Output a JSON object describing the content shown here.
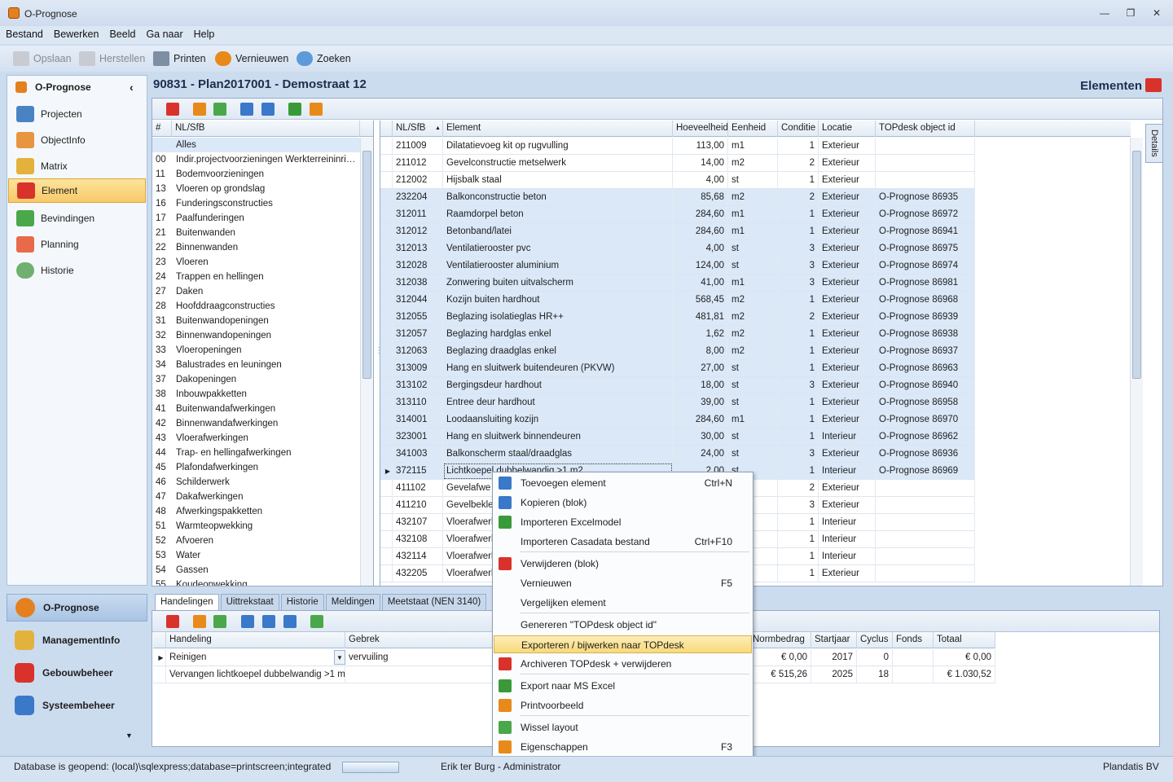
{
  "window": {
    "title": "O-Prognose"
  },
  "menu": [
    "Bestand",
    "Bewerken",
    "Beeld",
    "Ga naar",
    "Help"
  ],
  "toolbar": {
    "save": "Opslaan",
    "restore": "Herstellen",
    "print": "Printen",
    "refresh": "Vernieuwen",
    "search": "Zoeken"
  },
  "nav": {
    "header": "O-Prognose",
    "items": [
      "Projecten",
      "ObjectInfo",
      "Matrix",
      "Element",
      "Bevindingen",
      "Planning",
      "Historie"
    ],
    "selected": "Element",
    "modules": [
      "O-Prognose",
      "ManagementInfo",
      "Gebouwbeheer",
      "Systeembeheer"
    ]
  },
  "page": {
    "title": "90831 - Plan2017001 - Demostraat 12",
    "section": "Elementen",
    "details_tab": "Details"
  },
  "left_grid": {
    "headers": [
      "#",
      "NL/SfB"
    ],
    "rows": [
      [
        "",
        "Alles"
      ],
      [
        "00",
        "Indir.projectvoorzieningen Werkterreininrich..."
      ],
      [
        "11",
        "Bodemvoorzieningen"
      ],
      [
        "13",
        "Vloeren op grondslag"
      ],
      [
        "16",
        "Funderingsconstructies"
      ],
      [
        "17",
        "Paalfunderingen"
      ],
      [
        "21",
        "Buitenwanden"
      ],
      [
        "22",
        "Binnenwanden"
      ],
      [
        "23",
        "Vloeren"
      ],
      [
        "24",
        "Trappen en hellingen"
      ],
      [
        "27",
        "Daken"
      ],
      [
        "28",
        "Hoofddraagconstructies"
      ],
      [
        "31",
        "Buitenwandopeningen"
      ],
      [
        "32",
        "Binnenwandopeningen"
      ],
      [
        "33",
        "Vloeropeningen"
      ],
      [
        "34",
        "Balustrades en leuningen"
      ],
      [
        "37",
        "Dakopeningen"
      ],
      [
        "38",
        "Inbouwpakketten"
      ],
      [
        "41",
        "Buitenwandafwerkingen"
      ],
      [
        "42",
        "Binnenwandafwerkingen"
      ],
      [
        "43",
        "Vloerafwerkingen"
      ],
      [
        "44",
        "Trap- en hellingafwerkingen"
      ],
      [
        "45",
        "Plafondafwerkingen"
      ],
      [
        "46",
        "Schilderwerk"
      ],
      [
        "47",
        "Dakafwerkingen"
      ],
      [
        "48",
        "Afwerkingspakketten"
      ],
      [
        "51",
        "Warmteopwekking"
      ],
      [
        "52",
        "Afvoeren"
      ],
      [
        "53",
        "Water"
      ],
      [
        "54",
        "Gassen"
      ],
      [
        "55",
        "Koudeopwekking"
      ]
    ]
  },
  "element_grid": {
    "headers": [
      "NL/SfB",
      "Element",
      "Hoeveelheid",
      "Eenheid",
      "Conditie",
      "Locatie",
      "TOPdesk object id"
    ],
    "rows": [
      [
        "211009",
        "Dilatatievoeg kit op rugvulling",
        "113,00",
        "m1",
        "1",
        "Exterieur",
        ""
      ],
      [
        "211012",
        "Gevelconstructie metselwerk",
        "14,00",
        "m2",
        "2",
        "Exterieur",
        ""
      ],
      [
        "212002",
        "Hijsbalk staal",
        "4,00",
        "st",
        "1",
        "Exterieur",
        ""
      ],
      [
        "232204",
        "Balkonconstructie beton",
        "85,68",
        "m2",
        "2",
        "Exterieur",
        "O-Prognose 86935"
      ],
      [
        "312011",
        "Raamdorpel beton",
        "284,60",
        "m1",
        "1",
        "Exterieur",
        "O-Prognose 86972"
      ],
      [
        "312012",
        "Betonband/latei",
        "284,60",
        "m1",
        "1",
        "Exterieur",
        "O-Prognose 86941"
      ],
      [
        "312013",
        "Ventilatierooster pvc",
        "4,00",
        "st",
        "3",
        "Exterieur",
        "O-Prognose 86975"
      ],
      [
        "312028",
        "Ventilatierooster aluminium",
        "124,00",
        "st",
        "3",
        "Exterieur",
        "O-Prognose 86974"
      ],
      [
        "312038",
        "Zonwering buiten uitvalscherm",
        "41,00",
        "m1",
        "3",
        "Exterieur",
        "O-Prognose 86981"
      ],
      [
        "312044",
        "Kozijn buiten hardhout",
        "568,45",
        "m2",
        "1",
        "Exterieur",
        "O-Prognose 86968"
      ],
      [
        "312055",
        "Beglazing isolatieglas HR++",
        "481,81",
        "m2",
        "2",
        "Exterieur",
        "O-Prognose 86939"
      ],
      [
        "312057",
        "Beglazing hardglas enkel",
        "1,62",
        "m2",
        "1",
        "Exterieur",
        "O-Prognose 86938"
      ],
      [
        "312063",
        "Beglazing draadglas enkel",
        "8,00",
        "m2",
        "1",
        "Exterieur",
        "O-Prognose 86937"
      ],
      [
        "313009",
        "Hang en sluitwerk buitendeuren (PKVW)",
        "27,00",
        "st",
        "1",
        "Exterieur",
        "O-Prognose 86963"
      ],
      [
        "313102",
        "Bergingsdeur hardhout",
        "18,00",
        "st",
        "3",
        "Exterieur",
        "O-Prognose 86940"
      ],
      [
        "313110",
        "Entree deur hardhout",
        "39,00",
        "st",
        "1",
        "Exterieur",
        "O-Prognose 86958"
      ],
      [
        "314001",
        "Loodaansluiting kozijn",
        "284,60",
        "m1",
        "1",
        "Exterieur",
        "O-Prognose 86970"
      ],
      [
        "323001",
        "Hang en sluitwerk binnendeuren",
        "30,00",
        "st",
        "1",
        "Interieur",
        "O-Prognose 86962"
      ],
      [
        "341003",
        "Balkonscherm staal/draadglas",
        "24,00",
        "st",
        "3",
        "Exterieur",
        "O-Prognose 86936"
      ],
      [
        "372115",
        "Lichtkoepel dubbelwandig >1 m2",
        "2,00",
        "st",
        "1",
        "Interieur",
        "O-Prognose 86969"
      ],
      [
        "411102",
        "Gevelafwe",
        "",
        "",
        "2",
        "Exterieur",
        ""
      ],
      [
        "411210",
        "Gevelbekled",
        "",
        "",
        "3",
        "Exterieur",
        ""
      ],
      [
        "432107",
        "Vloerafwerk",
        "",
        "",
        "1",
        "Interieur",
        ""
      ],
      [
        "432108",
        "Vloerafwerk",
        "",
        "",
        "1",
        "Interieur",
        ""
      ],
      [
        "432114",
        "Vloerafwerk",
        "",
        "",
        "1",
        "Interieur",
        ""
      ],
      [
        "432205",
        "Vloerafwerk",
        "",
        "",
        "1",
        "Exterieur",
        ""
      ]
    ]
  },
  "bottom_tabs": [
    "Handelingen",
    "Uittrekstaat",
    "Historie",
    "Meldingen",
    "Meetstaat (NEN 3140)"
  ],
  "actions_grid": {
    "headers": [
      "Handeling",
      "Gebrek",
      "Normbedrag",
      "Startjaar",
      "Cyclus",
      "Fonds",
      "Totaal"
    ],
    "rows": [
      [
        "Reinigen",
        "vervuiling",
        "€ 0,00",
        "2017",
        "0",
        "",
        "€ 0,00"
      ],
      [
        "Vervangen lichtkoepel dubbelwandig >1 m2",
        "",
        "€ 515,26",
        "2025",
        "18",
        "",
        "€ 1.030,52"
      ]
    ]
  },
  "context_menu": [
    {
      "label": "Toevoegen element",
      "shortcut": "Ctrl+N",
      "icon": "plus-icon"
    },
    {
      "label": "Kopieren (blok)",
      "shortcut": "",
      "icon": "copy-icon"
    },
    {
      "label": "Importeren Excelmodel",
      "shortcut": "",
      "icon": "excel-icon"
    },
    {
      "label": "Importeren Casadata bestand",
      "shortcut": "Ctrl+F10",
      "icon": ""
    },
    {
      "label": "Verwijderen (blok)",
      "shortcut": "",
      "icon": "delete-icon"
    },
    {
      "label": "Vernieuwen",
      "shortcut": "F5",
      "icon": ""
    },
    {
      "label": "Vergelijken element",
      "shortcut": "",
      "icon": ""
    },
    {
      "label": "Genereren \"TOPdesk object id\"",
      "shortcut": "",
      "icon": ""
    },
    {
      "label": "Exporteren / bijwerken naar TOPdesk",
      "shortcut": "",
      "icon": ""
    },
    {
      "label": "Archiveren TOPdesk + verwijderen",
      "shortcut": "",
      "icon": "delete-icon"
    },
    {
      "label": "Export naar MS Excel",
      "shortcut": "",
      "icon": "excel-icon"
    },
    {
      "label": "Printvoorbeeld",
      "shortcut": "",
      "icon": "print-icon"
    },
    {
      "label": "Wissel layout",
      "shortcut": "",
      "icon": "layout-icon"
    },
    {
      "label": "Eigenschappen",
      "shortcut": "F3",
      "icon": "properties-icon"
    }
  ],
  "status": {
    "db": "Database is geopend: (local)\\sqlexpress;database=printscreen;integrated",
    "user": "Erik ter Burg - Administrator",
    "company": "Plandatis BV"
  },
  "colors": {
    "accent": "#f8c96a",
    "selection_row": "#dbe8f8",
    "header_text": "#1b2f4c",
    "delete_red": "#d9322b",
    "excel_green": "#3a9a3a",
    "orange": "#e88a1a",
    "blue": "#3a78c9"
  }
}
